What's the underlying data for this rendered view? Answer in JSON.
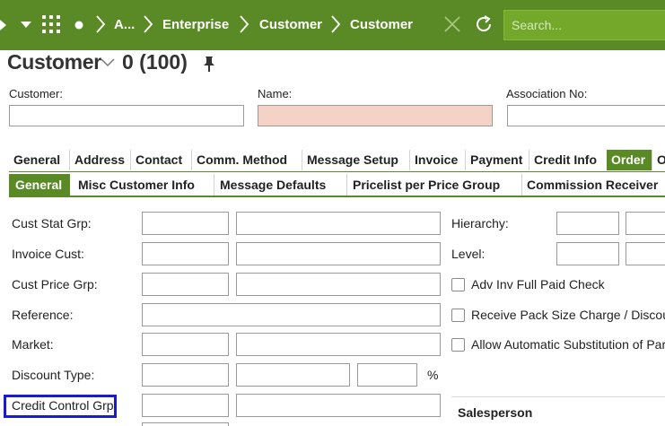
{
  "nav": {
    "breadcrumbs": [
      "A...",
      "Enterprise",
      "Customer",
      "Customer"
    ],
    "search_placeholder": "Search..."
  },
  "page": {
    "title": "Customer",
    "record_count": "0 (100)"
  },
  "header_fields": {
    "customer_label": "Customer:",
    "name_label": "Name:",
    "association_label": "Association No:"
  },
  "tabs_main": [
    "General",
    "Address",
    "Contact",
    "Comm. Method",
    "Message Setup",
    "Invoice",
    "Payment",
    "Credit Info",
    "Order",
    "O"
  ],
  "tabs_main_active": "Order",
  "tabs_sub": [
    "General",
    "Misc Customer Info",
    "Message Defaults",
    "Pricelist per Price Group",
    "Commission Receiver"
  ],
  "tabs_sub_active": "General",
  "form": {
    "cust_stat_grp": "Cust Stat Grp:",
    "invoice_cust": "Invoice Cust:",
    "cust_price_grp": "Cust Price Grp:",
    "reference": "Reference:",
    "market": "Market:",
    "discount_type": "Discount Type:",
    "percent": "%",
    "credit_control_grp": "Credit Control Grp",
    "hierarchy": "Hierarchy:",
    "level": "Level:",
    "adv_inv": "Adv Inv Full Paid Check",
    "receive_pack": "Receive Pack Size Charge / Discoun",
    "allow_auto": "Allow Automatic Substitution of Part",
    "salesperson": "Salesperson"
  },
  "colors": {
    "brand_green": "#5a8a26",
    "name_field_bg": "#f4d3c6",
    "highlight_blue": "#1a1ad0"
  }
}
